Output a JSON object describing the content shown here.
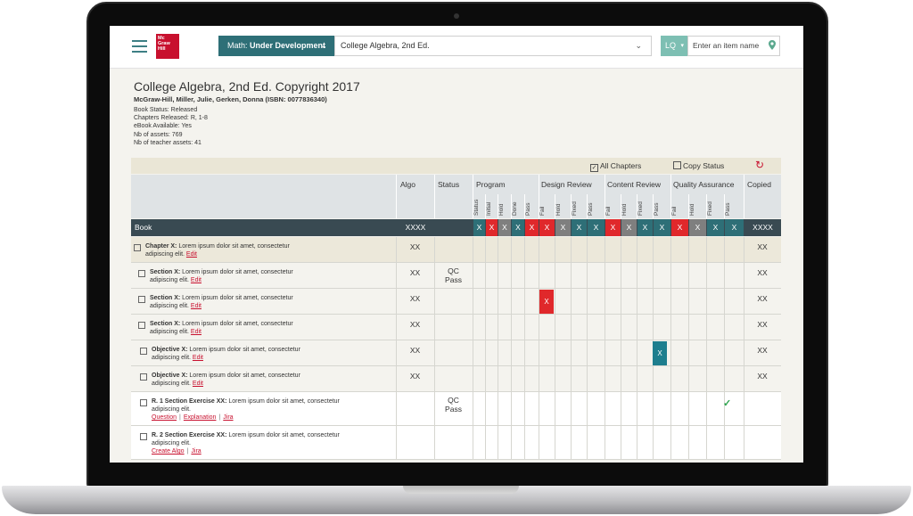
{
  "topbar": {
    "logo": "Mc Graw Hill Education",
    "subject_prefix": "Math: ",
    "subject_value": "Under Development",
    "book_select": "College Algebra, 2nd Ed.",
    "lq_label": "LQ",
    "item_search_placeholder": "Enter an item name"
  },
  "book": {
    "title": "College Algebra, 2nd Ed. Copyright 2017",
    "authors": "McGraw-Hill, Miller, Julie, Gerken, Donna (ISBN: 0077836340)",
    "meta": [
      "Book Status: Released",
      "Chapters Released: R, 1-8",
      "eBook Available: Yes",
      "Nb of assets: 769",
      "Nb of teacher assets: 41"
    ]
  },
  "table": {
    "all_chapters": "All Chapters",
    "copy_status": "Copy Status",
    "headers": {
      "algo": "Algo",
      "status": "Status",
      "program": "Program",
      "design": "Design Review",
      "content": "Content Review",
      "qa": "Quality Assurance",
      "copied": "Copied"
    },
    "program_sub": [
      "Status",
      "Initial",
      "Hold",
      "Done",
      "Pass"
    ],
    "review_sub": [
      "Fail",
      "Hold",
      "Fixed",
      "Pass"
    ],
    "book_row": {
      "label": "Book",
      "algo": "XXXX",
      "copied": "XXXX",
      "marks": [
        "X",
        "X",
        "X",
        "X",
        "X",
        "X",
        "X",
        "X",
        "X",
        "X",
        "X",
        "X",
        "X",
        "X",
        "X",
        "X",
        "X"
      ]
    },
    "rows": [
      {
        "type": "Chapter X:",
        "text": "Lorem ipsum dolor sit amet, consectetur",
        "text2": "adipiscing elit.",
        "link1": "Edit",
        "algo": "XX",
        "status": "",
        "copied": "XX"
      },
      {
        "type": "Section X:",
        "text": "Lorem ipsum dolor sit amet, consectetur",
        "text2": "adipiscing elit.",
        "link1": "Edit",
        "algo": "XX",
        "status": "QC Pass",
        "copied": "XX"
      },
      {
        "type": "Section X:",
        "text": "Lorem ipsum dolor sit amet, consectetur",
        "text2": "adipiscing elit.",
        "link1": "Edit",
        "algo": "XX",
        "status": "",
        "copied": "XX",
        "mark": "X"
      },
      {
        "type": "Section X:",
        "text": "Lorem ipsum dolor sit amet, consectetur",
        "text2": "adipiscing elit.",
        "link1": "Edit",
        "algo": "XX",
        "status": "",
        "copied": "XX"
      },
      {
        "type": "Objective X:",
        "text": "Lorem ipsum dolor sit amet, consectetur",
        "text2": "adipiscing elit.",
        "link1": "Edit",
        "algo": "XX",
        "status": "",
        "copied": "XX",
        "mark": "X"
      },
      {
        "type": "Objective X:",
        "text": "Lorem ipsum dolor sit amet, consectetur",
        "text2": "adipiscing elit.",
        "link1": "Edit",
        "algo": "XX",
        "status": "",
        "copied": "XX"
      },
      {
        "type": "R. 1 Section Exercise XX:",
        "text": "Lorem ipsum dolor sit amet, consectetur",
        "text2": "adipiscing elit.",
        "link1": "Question",
        "link2": "Explanation",
        "link3": "Jira",
        "algo": "",
        "status": "QC Pass",
        "copied": ""
      },
      {
        "type": "R. 2 Section Exercise XX:",
        "text": "Lorem ipsum dolor sit amet, consectetur",
        "text2": "adipiscing elit.",
        "link1": "Create Algo",
        "link2": "Jira",
        "algo": "",
        "status": "",
        "copied": ""
      }
    ]
  },
  "colors": {
    "teal": "#2e6f77",
    "red": "#e0282b",
    "gray": "#7f7f7f",
    "mark_teal": "#1e7e8e",
    "book_row": "#394a52"
  }
}
